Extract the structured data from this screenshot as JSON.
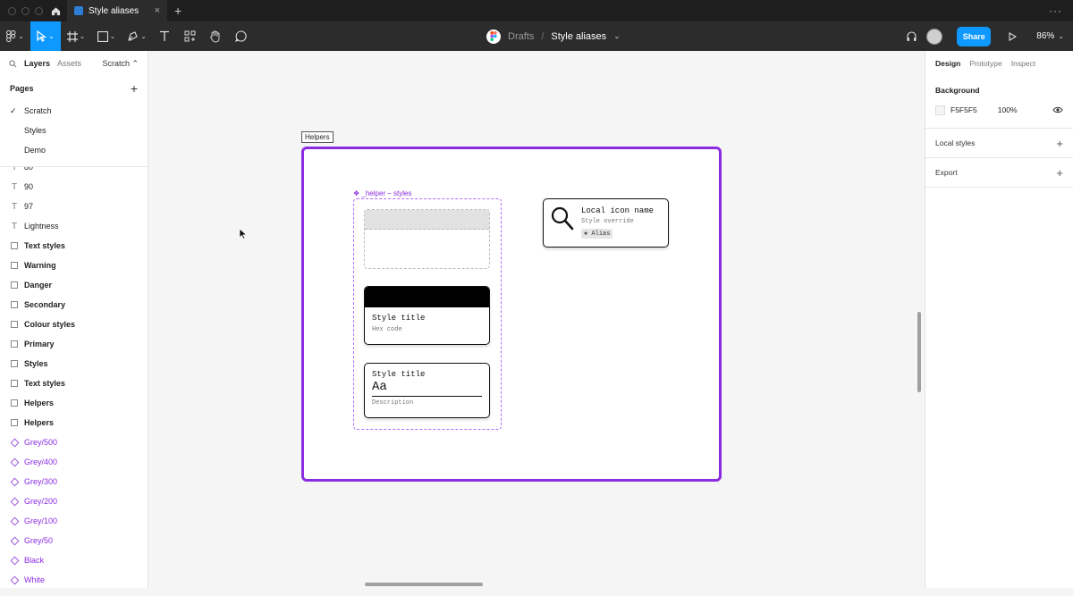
{
  "tabs": {
    "file_tab_label": "Style aliases",
    "new_tab": "+",
    "more": "···"
  },
  "toolbar": {
    "breadcrumb_drafts": "Drafts",
    "breadcrumb_sep": "/",
    "file_name": "Style aliases",
    "file_chevron": "⌄",
    "share_label": "Share",
    "zoom": "86%",
    "accent_color": "#0D99FF"
  },
  "left_panel": {
    "tab_layers": "Layers",
    "tab_assets": "Assets",
    "page_selector": "Scratch ⌃",
    "pages_header": "Pages",
    "pages_plus": "+",
    "pages": [
      {
        "label": "Scratch",
        "check": "✓"
      },
      {
        "label": "Styles"
      },
      {
        "label": "Demo"
      }
    ],
    "layers": [
      {
        "label": "80",
        "icon": "text-icon"
      },
      {
        "label": "90",
        "icon": "text-icon"
      },
      {
        "label": "97",
        "icon": "text-icon"
      },
      {
        "label": "Lightness",
        "icon": "text-icon"
      },
      {
        "label": "Text styles",
        "icon": "frame-icon"
      },
      {
        "label": "Warning",
        "icon": "frame-icon"
      },
      {
        "label": "Danger",
        "icon": "frame-icon"
      },
      {
        "label": "Secondary",
        "icon": "frame-icon"
      },
      {
        "label": "Colour styles",
        "icon": "frame-icon"
      },
      {
        "label": "Primary",
        "icon": "frame-icon"
      },
      {
        "label": "Styles",
        "icon": "frame-icon"
      },
      {
        "label": "Text styles",
        "icon": "frame-icon"
      },
      {
        "label": "Helpers",
        "icon": "frame-icon"
      },
      {
        "label": "Helpers",
        "icon": "frame-icon"
      },
      {
        "label": "Grey/500",
        "icon": "component-icon"
      },
      {
        "label": "Grey/400",
        "icon": "component-icon"
      },
      {
        "label": "Grey/300",
        "icon": "component-icon"
      },
      {
        "label": "Grey/200",
        "icon": "component-icon"
      },
      {
        "label": "Grey/100",
        "icon": "component-icon"
      },
      {
        "label": "Grey/50",
        "icon": "component-icon"
      },
      {
        "label": "Black",
        "icon": "component-icon"
      },
      {
        "label": "White",
        "icon": "component-icon"
      }
    ]
  },
  "canvas": {
    "frame_label": "Helpers",
    "helper_label": "❖ _helper – styles",
    "colour_card": {
      "title": "Style title",
      "subtitle": "Hex code"
    },
    "text_card": {
      "title": "Style title",
      "sample": "Aa",
      "subtitle": "Description"
    },
    "icon_card": {
      "title": "Local icon name",
      "subtitle": "Style override",
      "alias": "❖ Alias"
    },
    "frame_color": "#8A2BE2"
  },
  "right_panel": {
    "tab_design": "Design",
    "tab_prototype": "Prototype",
    "tab_inspect": "Inspect",
    "background_header": "Background",
    "background_hex": "F5F5F5",
    "background_opacity": "100%",
    "local_styles": "Local styles",
    "export": "Export",
    "plus": "+"
  }
}
